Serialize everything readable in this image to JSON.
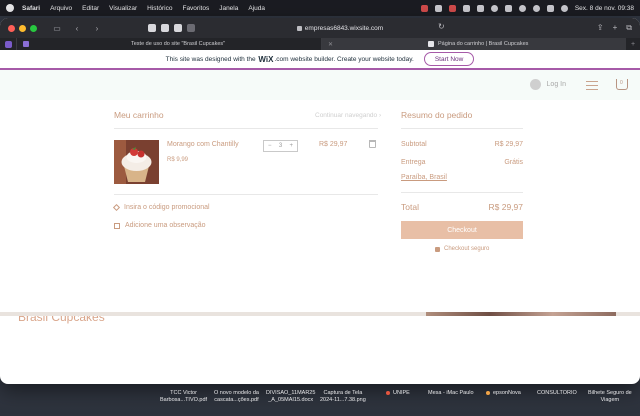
{
  "menubar": {
    "app": "Safari",
    "items": [
      "Arquivo",
      "Editar",
      "Visualizar",
      "Histórico",
      "Favoritos",
      "Janela",
      "Ajuda"
    ],
    "datetime": "Sex. 8 de nov.  09:38"
  },
  "browser": {
    "address": "empresas6843.wixsite.com",
    "tabs": [
      {
        "title": "Teste de uso do site \"Brasil Cupcakes\""
      },
      {
        "title": "Página do carrinho | Brasil Cupcakes"
      }
    ]
  },
  "wix_banner": {
    "text_before": "This site was designed with the",
    "logo": "WiX",
    "text_after": ".com website builder. Create your website today.",
    "button": "Start Now"
  },
  "site_header": {
    "login": "Log In",
    "cart_count": "0"
  },
  "cart": {
    "title": "Meu carrinho",
    "continue": "Continuar navegando",
    "item": {
      "name": "Morango com Chantilly",
      "unit_price": "R$ 9,99",
      "quantity": "3",
      "minus": "−",
      "plus": "+",
      "line_price": "R$ 29,97"
    },
    "promo": "Insira o código promocional",
    "note": "Adicione uma observação"
  },
  "summary": {
    "title": "Resumo do pedido",
    "subtotal_label": "Subtotal",
    "subtotal_value": "R$ 29,97",
    "delivery_label": "Entrega",
    "delivery_value": "Grátis",
    "delivery_location": "Paraíba, Brasil",
    "total_label": "Total",
    "total_value": "R$ 29,97",
    "checkout_button": "Checkout",
    "secure": "Checkout seguro"
  },
  "brand": "Brasil Cupcakes",
  "desktop_files": [
    {
      "line1": "TCC Victor",
      "line2": "Barbosa...TIVO.pdf"
    },
    {
      "line1": "O novo modelo da",
      "line2": "cascata...ções.pdf"
    },
    {
      "line1": "DIVISAO_11MAR25",
      "line2": "_A_05MAI15.docx"
    },
    {
      "line1": "Captura de Tela",
      "line2": "2024-11...7.38.png"
    },
    {
      "line1": "UNIPE",
      "line2": ""
    },
    {
      "line1": "Mesa - iMac Paulo",
      "line2": ""
    },
    {
      "line1": "epsonNova",
      "line2": ""
    },
    {
      "line1": "CONSULTORIO",
      "line2": ""
    },
    {
      "line1": "Bilhete Seguro de",
      "line2": "Viagem"
    }
  ],
  "colors": {
    "accent": "#c99b7f",
    "checkout": "#e8bfa6",
    "wix_border": "#a65aa8"
  }
}
